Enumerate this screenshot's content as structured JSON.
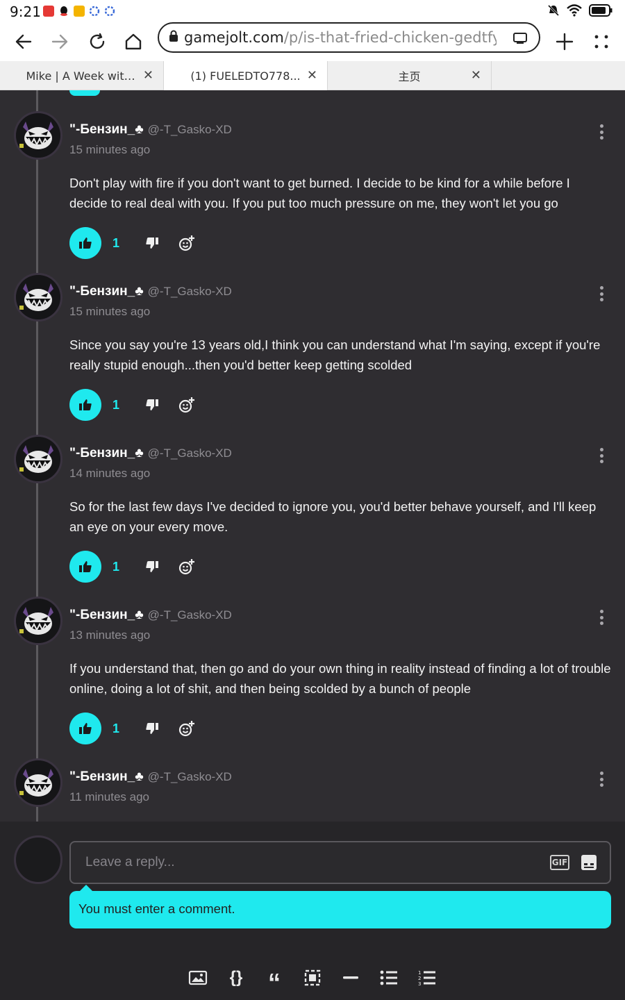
{
  "status_bar": {
    "time": "9:21",
    "notification_colors": [
      "#e53935",
      "#111111",
      "#f4b400",
      "#3b6bd8",
      "#3b6bd8"
    ]
  },
  "browser": {
    "url_host": "gamejolt.com",
    "url_path": "/p/is-that-fried-chicken-gedtfyvr",
    "tabs": [
      {
        "label": "Mike | A Week with...",
        "active": false
      },
      {
        "label": "(1) FUELEDTO778...",
        "active": true
      },
      {
        "label": "主页",
        "active": false
      }
    ]
  },
  "accent_color": "#1fe9ee",
  "comments": [
    {
      "author": "\"-Бензин_♣",
      "handle": "@-T_Gasko-XD",
      "time": "15 minutes ago",
      "text": "Don't play with fire if you don't want to get burned. I decide to be kind for a while before I decide to real deal with you. If you put too much pressure on me, they won't let you go",
      "likes": "1"
    },
    {
      "author": "\"-Бензин_♣",
      "handle": "@-T_Gasko-XD",
      "time": "15 minutes ago",
      "text": "Since you say you're 13 years old,I think you can understand what I'm saying, except if you're really stupid enough...then you'd better keep getting scolded",
      "likes": "1"
    },
    {
      "author": "\"-Бензин_♣",
      "handle": "@-T_Gasko-XD",
      "time": "14 minutes ago",
      "text": "So for the last few days I've decided to ignore you, you'd better behave yourself, and I'll keep an eye on your every move.",
      "likes": "1"
    },
    {
      "author": "\"-Бензин_♣",
      "handle": "@-T_Gasko-XD",
      "time": "13 minutes ago",
      "text": "If you understand that, then go and do your own thing in reality instead of finding a lot of trouble online, doing a lot of shit, and then being scolded by a bunch of people",
      "likes": "1"
    },
    {
      "author": "\"-Бензин_♣",
      "handle": "@-T_Gasko-XD",
      "time": "11 minutes ago"
    }
  ],
  "reply": {
    "placeholder": "Leave a reply...",
    "gif_label": "GIF",
    "error": "You must enter a comment."
  },
  "toolbar_icons": [
    "image-icon",
    "code-braces-icon",
    "quote-icon",
    "spoiler-icon",
    "horizontal-rule-icon",
    "bullet-list-icon",
    "numbered-list-icon"
  ]
}
